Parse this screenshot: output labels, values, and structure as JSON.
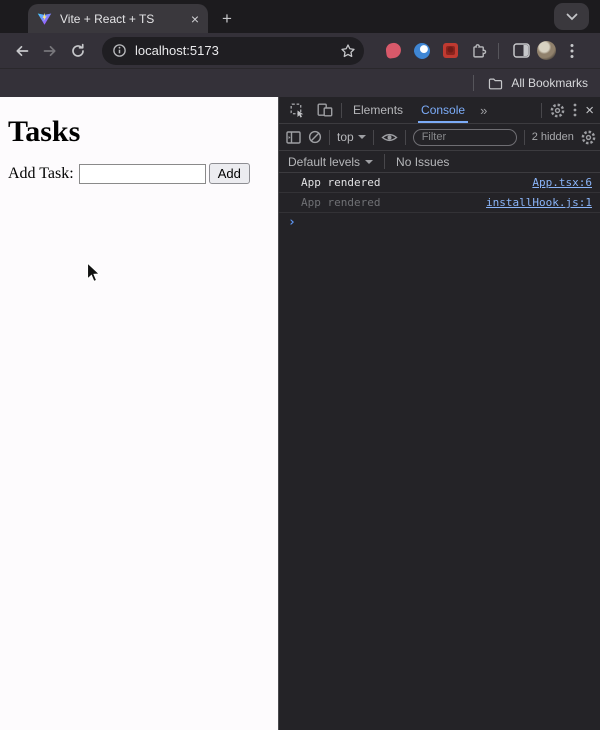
{
  "window": {
    "tab_title": "Vite + React + TS",
    "url": "localhost:5173",
    "all_bookmarks_label": "All Bookmarks"
  },
  "glyphs": {
    "tab_close": "×",
    "new_tab": "+",
    "more_tabs": "»",
    "devtools_close": "×",
    "prompt": "›"
  },
  "page": {
    "title": "Tasks",
    "add_task_label": "Add Task:",
    "task_input_value": "",
    "add_button_label": "Add"
  },
  "devtools": {
    "tabs": {
      "elements": "Elements",
      "console": "Console"
    },
    "toolbar": {
      "context_selector": "top",
      "filter_placeholder": "Filter",
      "hidden_badge": "2 hidden"
    },
    "levels_bar": {
      "default_levels": "Default levels",
      "no_issues": "No Issues"
    },
    "messages": [
      {
        "text": "App rendered",
        "source_link": "App.tsx:6"
      },
      {
        "text": "App rendered",
        "source_link": "installHook.js:1"
      }
    ]
  },
  "colors": {
    "accent_blue": "#7cacf8",
    "link_blue": "#8ab4f8",
    "devtools_bg": "#242327",
    "chrome_toolbar": "#343139",
    "tabstrip_bg": "#1c1b1e",
    "page_bg": "#fdfbfd"
  }
}
